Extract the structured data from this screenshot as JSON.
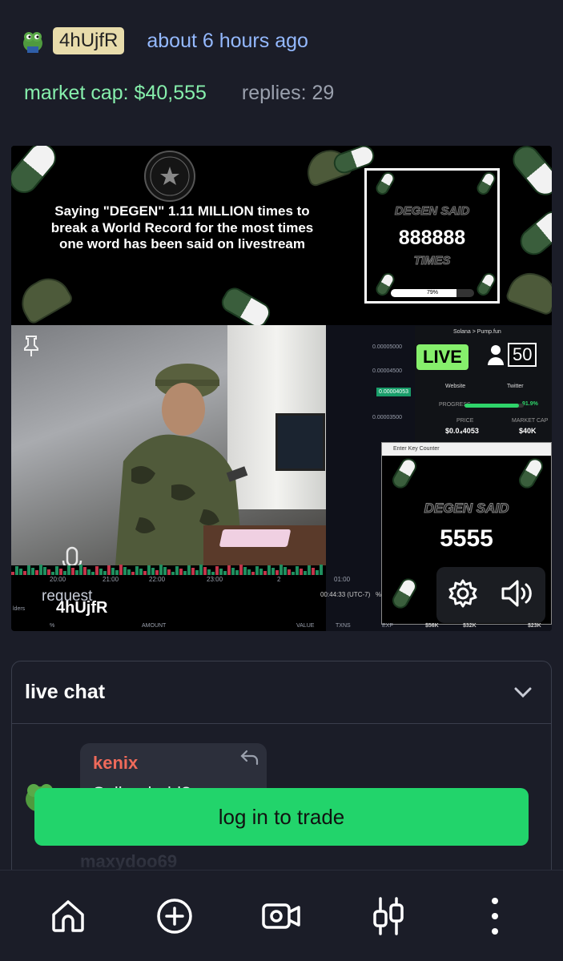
{
  "top_cut_text": "",
  "creator": {
    "handle": "4hUjfR",
    "time_ago": "about 6 hours ago"
  },
  "stats": {
    "market_cap": "market cap: $40,555",
    "replies": "replies: 29"
  },
  "stream": {
    "banner_text": "Saying \"DEGEN\" 1.11 MILLION times to break a World Record for the most times one word has been said on livestream",
    "counter_label_top": "DEGEN SAID",
    "counter_value": "888888",
    "counter_label_bottom": "TIMES",
    "counter_progress": 0.79,
    "counter_progress_text": "79%",
    "live_label": "LIVE",
    "viewers": "50",
    "overlay_breadcrumb": "Solana > Pump.fun",
    "website_label": "Website",
    "twitter_label": "Twitter",
    "progress_label": "PROGRESS",
    "progress_value": "91.9%",
    "progress_fraction": 0.919,
    "price_label": "PRICE",
    "price_value": "$0.0₄4053",
    "mcap_label": "MARKET CAP",
    "mcap_value": "$40K",
    "key_window_title": "Enter Key Counter",
    "key_said": "DEGEN SAID",
    "key_value": "5555",
    "price_ticks": [
      "0.00005000",
      "0.00004500",
      "0.00003500"
    ],
    "price_current": "0.00004053",
    "time_ticks": [
      "20:00",
      "21:00",
      "22:00",
      "23:00",
      "2",
      "01:00"
    ],
    "clock": "00:44:33 (UTC-7)",
    "clock_pct": "%",
    "request_label": "request",
    "request_handle": "4hUjfR",
    "holders_label": "lders",
    "table_cols": [
      "%",
      "AMOUNT",
      "VALUE",
      "TXNS",
      "EXP"
    ],
    "mcap_marks": [
      "$56K",
      "$32K",
      "$23K"
    ]
  },
  "live_chat": {
    "title": "live chat",
    "messages": [
      {
        "user": "kenix",
        "text": "Sell or hold?"
      }
    ],
    "ghost_user": "maxydoo69"
  },
  "cta": {
    "label": "log in to trade"
  },
  "nav": [
    "home-icon",
    "plus-circle-icon",
    "video-icon",
    "candles-icon",
    "more-vertical-icon"
  ],
  "colors": {
    "accent": "#22d46b",
    "mcap": "#86efac",
    "time": "#94b9ff",
    "badge": "#e8dcab",
    "chat_user": "#ef6a5a"
  }
}
